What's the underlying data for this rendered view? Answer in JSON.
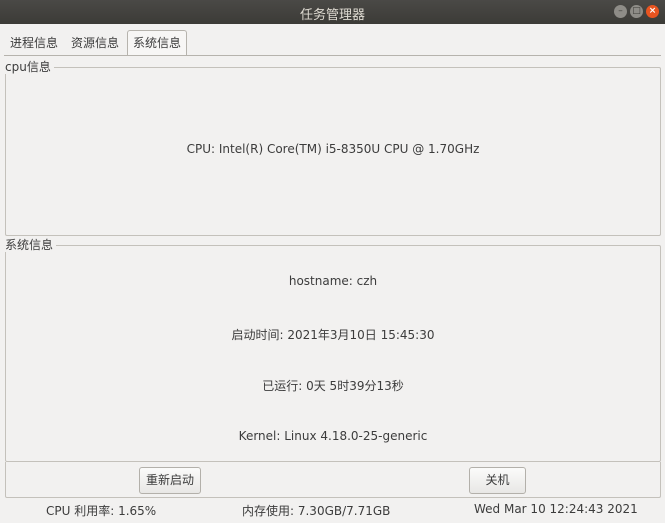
{
  "window": {
    "title": "任务管理器",
    "controls": {
      "minimize": "–",
      "maximize": "□",
      "close": "×"
    }
  },
  "tabs": [
    {
      "label": "进程信息"
    },
    {
      "label": "资源信息"
    },
    {
      "label": "系统信息",
      "active": true
    }
  ],
  "cpu_group": {
    "title": "cpu信息",
    "cpu_line": "CPU:  Intel(R) Core(TM) i5-8350U CPU @ 1.70GHz"
  },
  "system_group": {
    "title": "系统信息",
    "hostname_line": "hostname:  czh",
    "boot_time_line": "启动时间:  2021年3月10日 15:45:30",
    "uptime_line": "已运行:  0天 5时39分13秒",
    "kernel_line": "Kernel:  Linux 4.18.0-25-generic"
  },
  "buttons": {
    "restart": "重新启动",
    "shutdown": "关机"
  },
  "status_bar": {
    "cpu_usage": "CPU 利用率:   1.65%",
    "memory_usage": "内存使用:   7.30GB/7.71GB",
    "datetime": "Wed Mar 10 12:24:43 2021"
  },
  "colors": {
    "titlebar": "#3c3b37",
    "close_button": "#e95420",
    "window_bg": "#f2f1f0"
  }
}
